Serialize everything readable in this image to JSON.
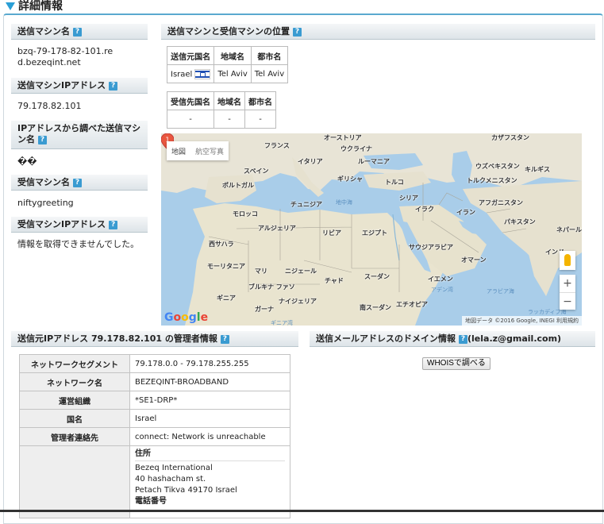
{
  "page": {
    "title": "詳細情報"
  },
  "sections": {
    "sender_machine_name": {
      "label": "送信マシン名",
      "value_line1": "bzq-79-178-82-101.re",
      "value_line2": "d.bezeqint.net"
    },
    "sender_ip": {
      "label": "送信マシンIPアドレス",
      "value": "79.178.82.101"
    },
    "sender_name_from_ip": {
      "label_line1": "IPアドレスから調べた送信マシ",
      "label_line2": "ン名",
      "value": "��"
    },
    "receiver_machine_name": {
      "label": "受信マシン名",
      "value": "niftygreeting"
    },
    "receiver_ip": {
      "label": "受信マシンIPアドレス",
      "value": "情報を取得できませんでした。"
    },
    "location": {
      "label": "送信マシンと受信マシンの位置",
      "sender_headers": [
        "送信元国名",
        "地域名",
        "都市名"
      ],
      "sender_row": [
        "Israel",
        "Tel Aviv",
        "Tel Aviv"
      ],
      "receiver_headers": [
        "受信先国名",
        "地域名",
        "都市名"
      ],
      "receiver_row": [
        "-",
        "-",
        "-"
      ]
    },
    "admin_info": {
      "label": "送信元IPアドレス 79.178.82.101 の管理者情報",
      "rows": [
        {
          "key": "ネットワークセグメント",
          "value": "79.178.0.0 - 79.178.255.255"
        },
        {
          "key": "ネットワーク名",
          "value": "BEZEQINT-BROADBAND"
        },
        {
          "key": "運営組織",
          "value": "*SE1-DRP*"
        },
        {
          "key": "国名",
          "value": "Israel"
        },
        {
          "key": "管理者連絡先",
          "value": "connect: Network is unreachable"
        }
      ],
      "address": {
        "title": "住所",
        "lines": [
          "Bezeq International",
          "40 hashacham st.",
          "Petach Tikva 49170 Israel"
        ],
        "phone_title": "電話番号"
      }
    },
    "domain_info": {
      "label": "送信メールアドレスのドメイン情報",
      "email": "(lela.z@gmail.com)",
      "button": "WHOISで調べる"
    }
  },
  "map": {
    "type_map": "地図",
    "type_satellite": "航空写真",
    "zoom_in": "+",
    "zoom_out": "−",
    "marker_label": "1",
    "attribution": "地図データ ©2016 Google, INEGI   利用規約",
    "google": "Google",
    "labels": {
      "austria": "オーストリア",
      "france": "フランス",
      "ukraine": "ウクライナ",
      "kazakhstan": "カザフスタン",
      "italy": "イタリア",
      "romania": "ルーマニア",
      "uzbekistan": "ウズベキスタン",
      "kyrgyz": "キルギス",
      "spain": "スペイン",
      "greece": "ギリシャ",
      "turkey": "トルコ",
      "turkmenistan": "トルクメニスタン",
      "portugal": "ポルトガル",
      "mediterranean": "地中海",
      "syria": "シリア",
      "afghanistan": "アフガニスタン",
      "tunisia": "チュニジア",
      "iraq": "イラク",
      "iran": "イラン",
      "morocco": "モロッコ",
      "pakistan": "パキスタン",
      "algeria": "アルジェリア",
      "libya": "リビア",
      "egypt": "エジプト",
      "nepal": "ネパール",
      "w_sahara": "西サハラ",
      "saudi": "サウジアラビア",
      "oman": "オマーン",
      "india": "インド",
      "mauritania": "モーリタニア",
      "mali": "マリ",
      "niger": "ニジェール",
      "sudan": "スーダン",
      "chad": "チャド",
      "yemen": "イエメン",
      "burkina": "ブルキナ ファソ",
      "gulf_aden": "アデン湾",
      "arabian_sea": "アラビア海",
      "guinea": "ギニア",
      "nigeria": "ナイジェリア",
      "s_sudan": "南スーダン",
      "ethiopia": "エチオピア",
      "ghana": "ガーナ",
      "laccadive": "ラッカディブ海",
      "gulf_guinea": "ギニア湾"
    }
  }
}
